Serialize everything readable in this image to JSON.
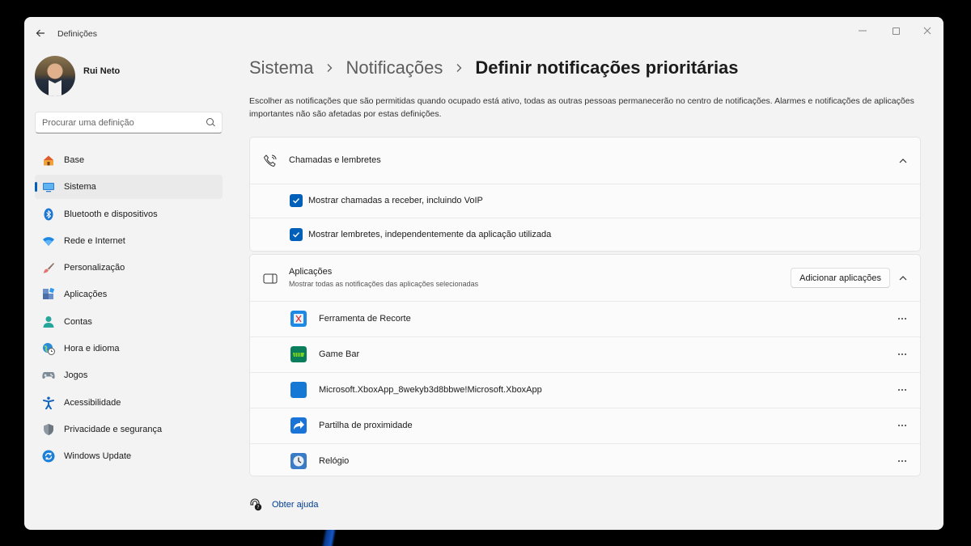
{
  "window": {
    "title": "Definições"
  },
  "user": {
    "name": "Rui Neto"
  },
  "search": {
    "placeholder": "Procurar uma definição"
  },
  "sidebar": {
    "items": [
      {
        "label": "Base",
        "icon": "home-icon"
      },
      {
        "label": "Sistema",
        "icon": "system-icon",
        "active": true
      },
      {
        "label": "Bluetooth e dispositivos",
        "icon": "bluetooth-icon"
      },
      {
        "label": "Rede e Internet",
        "icon": "wifi-icon"
      },
      {
        "label": "Personalização",
        "icon": "brush-icon"
      },
      {
        "label": "Aplicações",
        "icon": "apps-icon"
      },
      {
        "label": "Contas",
        "icon": "account-icon"
      },
      {
        "label": "Hora e idioma",
        "icon": "globe-clock-icon"
      },
      {
        "label": "Jogos",
        "icon": "gamepad-icon"
      },
      {
        "label": "Acessibilidade",
        "icon": "accessibility-icon"
      },
      {
        "label": "Privacidade e segurança",
        "icon": "shield-icon"
      },
      {
        "label": "Windows Update",
        "icon": "update-icon"
      }
    ]
  },
  "breadcrumb": {
    "level1": "Sistema",
    "level2": "Notificações",
    "current": "Definir notificações prioritárias"
  },
  "description": "Escolher as notificações que são permitidas quando ocupado está ativo, todas as outras pessoas permanecerão no centro de notificações. Alarmes e notificações de aplicações importantes não são afetadas por estas definições.",
  "calls": {
    "title": "Chamadas e lembretes",
    "options": [
      {
        "label": "Mostrar chamadas a receber, incluindo VoIP",
        "checked": true
      },
      {
        "label": "Mostrar lembretes, independentemente da aplicação utilizada",
        "checked": true
      }
    ]
  },
  "apps": {
    "title": "Aplicações",
    "subtitle": "Mostrar todas as notificações das aplicações selecionadas",
    "add_label": "Adicionar aplicações",
    "list": [
      {
        "label": "Ferramenta de Recorte",
        "icon": "snipping-tool-icon"
      },
      {
        "label": "Game Bar",
        "icon": "game-bar-icon"
      },
      {
        "label": "Microsoft.XboxApp_8wekyb3d8bbwe!Microsoft.XboxApp",
        "icon": "xbox-app-icon"
      },
      {
        "label": "Partilha de proximidade",
        "icon": "nearby-share-icon"
      },
      {
        "label": "Relógio",
        "icon": "clock-icon"
      }
    ]
  },
  "help": {
    "label": "Obter ajuda"
  },
  "colors": {
    "accent": "#005fb8",
    "background": "#f3f3f3",
    "card": "#fbfbfb"
  }
}
